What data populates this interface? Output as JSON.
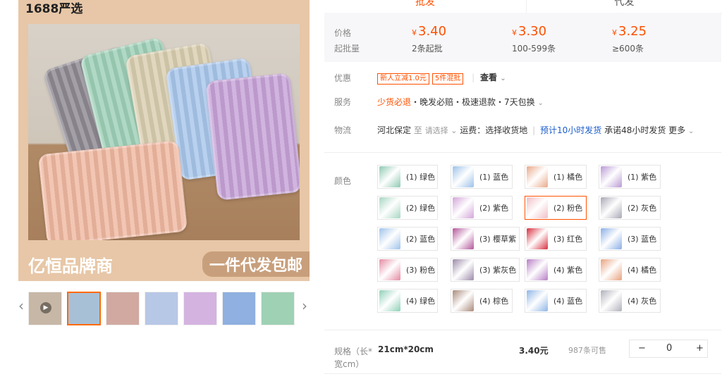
{
  "gallery": {
    "brand_label": "1688严选",
    "footer_left": "亿恒品牌商",
    "footer_right": "一件代发包邮",
    "prev_icon": "chevron-left-icon",
    "next_icon": "chevron-right-icon",
    "thumb_colors": [
      "#c7b7a6",
      "#a8c0d6",
      "#d1a9a0",
      "#b7c7e6",
      "#d4b3e0",
      "#8fb0e0",
      "#9fd1b5"
    ]
  },
  "tabs": [
    "批发",
    "代发"
  ],
  "pricing": {
    "price_label": "价格",
    "moq_label": "起批量",
    "tiers": [
      {
        "currency": "¥",
        "price": "3.40",
        "qty": "2条起批"
      },
      {
        "currency": "¥",
        "price": "3.30",
        "qty": "100-599条"
      },
      {
        "currency": "¥",
        "price": "3.25",
        "qty": "≥600条"
      }
    ]
  },
  "promo": {
    "label": "优惠",
    "badges": [
      "新人立减1.0元",
      "5件混批"
    ],
    "view": "查看"
  },
  "service": {
    "label": "服务",
    "highlight": "少货必退",
    "rest": "・晚发必赔・极速退款・7天包换"
  },
  "logistics": {
    "label": "物流",
    "origin": "河北保定",
    "to": "至",
    "dest_placeholder": "请选择",
    "fee": "运费：选择收货地",
    "eta": "预计10小时发货",
    "promise": "承诺48小时发货",
    "more": "更多"
  },
  "colors": {
    "label": "颜色",
    "options": [
      {
        "name": "(1) 绿色",
        "c": "#8fc9b3"
      },
      {
        "name": "(1) 蓝色",
        "c": "#9cc2e8"
      },
      {
        "name": "(1) 橘色",
        "c": "#e9a98b"
      },
      {
        "name": "(1) 紫色",
        "c": "#b99ad4"
      },
      {
        "name": "(2) 绿色",
        "c": "#a7d6c3"
      },
      {
        "name": "(2) 紫色",
        "c": "#d3a5d9"
      },
      {
        "name": "(2) 粉色",
        "c": "#f0bfc6"
      },
      {
        "name": "(2) 灰色",
        "c": "#a8a8b5"
      },
      {
        "name": "(2) 蓝色",
        "c": "#9fc3ea"
      },
      {
        "name": "(3) 樱草紫",
        "c": "#b3569a"
      },
      {
        "name": "(3) 红色",
        "c": "#d7303f"
      },
      {
        "name": "(3) 蓝色",
        "c": "#8aaee6"
      },
      {
        "name": "(3) 粉色",
        "c": "#e48aa2"
      },
      {
        "name": "(3) 紫灰色",
        "c": "#9b8aa8"
      },
      {
        "name": "(4) 紫色",
        "c": "#b67fc4"
      },
      {
        "name": "(4) 橘色",
        "c": "#e8a27f"
      },
      {
        "name": "(4) 绿色",
        "c": "#8fd0b8"
      },
      {
        "name": "(4) 棕色",
        "c": "#a98a7a"
      },
      {
        "name": "(4) 蓝色",
        "c": "#8fb5e5"
      },
      {
        "name": "(4) 灰色",
        "c": "#b0b0bb"
      }
    ],
    "selected_index": 6
  },
  "spec": {
    "label": "规格（长*宽cm）",
    "size": "21cm*20cm",
    "price": "3.40元",
    "stock": "987条可售",
    "minus": "−",
    "qty": "0",
    "plus": "+"
  },
  "accent": "#ff5000"
}
